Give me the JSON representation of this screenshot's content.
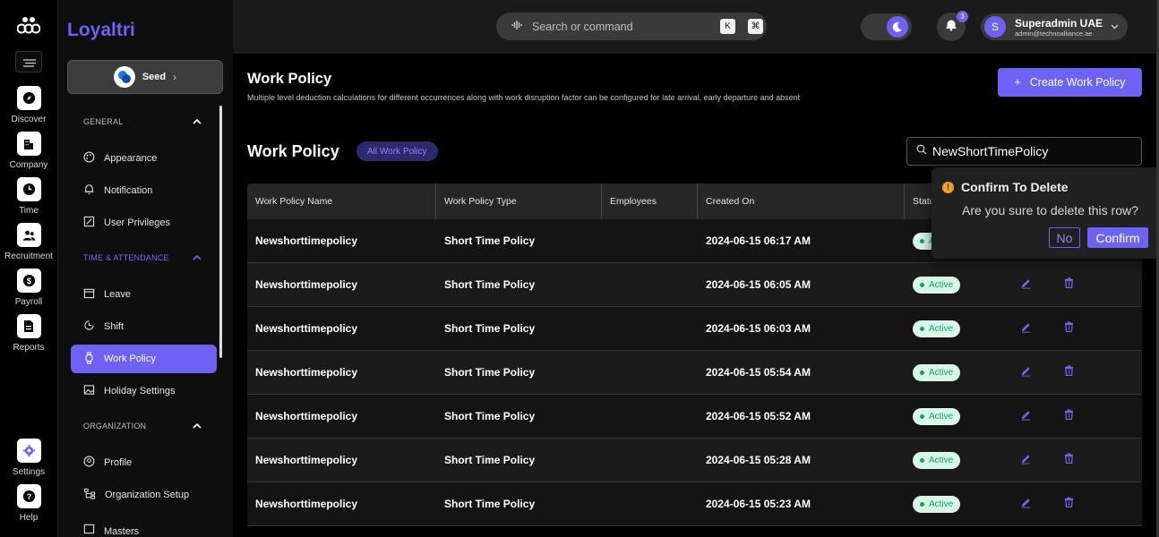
{
  "rail": {
    "items": [
      {
        "label": "Discover",
        "icon": "compass-icon"
      },
      {
        "label": "Company",
        "icon": "building-icon"
      },
      {
        "label": "Time",
        "icon": "clock-icon"
      },
      {
        "label": "Recruitment",
        "icon": "people-icon"
      },
      {
        "label": "Payroll",
        "icon": "dollar-icon"
      },
      {
        "label": "Reports",
        "icon": "report-icon"
      }
    ],
    "bottom": [
      {
        "label": "Settings",
        "icon": "gear-icon"
      },
      {
        "label": "Help",
        "icon": "help-icon"
      }
    ]
  },
  "sidebar": {
    "brand": "Loyaltri",
    "org_switcher": "Seed",
    "sections": [
      {
        "title": "GENERAL",
        "items": [
          "Appearance",
          "Notification",
          "User Privileges"
        ]
      },
      {
        "title": "TIME & ATTENDANCE",
        "items": [
          "Leave",
          "Shift",
          "Work Policy",
          "Holiday Settings"
        ]
      },
      {
        "title": "ORGANIZATION",
        "items": [
          "Profile",
          "Organization Setup",
          "Masters"
        ]
      }
    ],
    "selected": "Work Policy"
  },
  "topbar": {
    "search_placeholder": "Search or command",
    "kbd_1": "K",
    "kbd_2": "⌘",
    "notification_count": "3",
    "user_initial": "S",
    "user_name": "Superadmin UAE",
    "user_email": "admin@technoalliance.ae"
  },
  "page": {
    "title": "Work Policy",
    "description": "Multiple level deduction calculations for different occurrences along with work disruption factor can be configured for late arrival, early departure and absent",
    "create_button": "Create Work Policy",
    "list_title": "Work Policy",
    "filter_badge": "All Work Policy",
    "search_value": "NewShortTimePolicy"
  },
  "table": {
    "columns": [
      "Work Policy Name",
      "Work Policy Type",
      "Employees",
      "Created On",
      "Status",
      ""
    ],
    "rows": [
      {
        "name": "Newshorttimepolicy",
        "type": "Short Time Policy",
        "employees": "",
        "created": "2024-06-15 06:17 AM",
        "status": "Active"
      },
      {
        "name": "Newshorttimepolicy",
        "type": "Short Time Policy",
        "employees": "",
        "created": "2024-06-15 06:05 AM",
        "status": "Active"
      },
      {
        "name": "Newshorttimepolicy",
        "type": "Short Time Policy",
        "employees": "",
        "created": "2024-06-15 06:03 AM",
        "status": "Active"
      },
      {
        "name": "Newshorttimepolicy",
        "type": "Short Time Policy",
        "employees": "",
        "created": "2024-06-15 05:54 AM",
        "status": "Active"
      },
      {
        "name": "Newshorttimepolicy",
        "type": "Short Time Policy",
        "employees": "",
        "created": "2024-06-15 05:52 AM",
        "status": "Active"
      },
      {
        "name": "Newshorttimepolicy",
        "type": "Short Time Policy",
        "employees": "",
        "created": "2024-06-15 05:28 AM",
        "status": "Active"
      },
      {
        "name": "Newshorttimepolicy",
        "type": "Short Time Policy",
        "employees": "",
        "created": "2024-06-15 05:23 AM",
        "status": "Active"
      }
    ]
  },
  "popconfirm": {
    "title": "Confirm To Delete",
    "message": "Are you sure to delete this row?",
    "cancel": "No",
    "confirm": "Confirm"
  },
  "colors": {
    "accent": "#6d62f2",
    "status_bg": "#d7f8e9",
    "status_text": "#1e9b5f",
    "warning": "#f0a020"
  }
}
